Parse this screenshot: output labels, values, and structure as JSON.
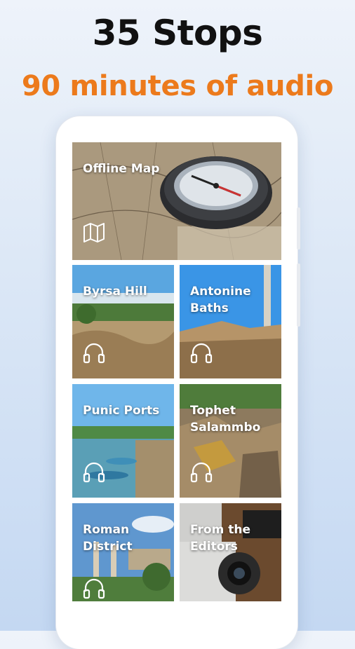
{
  "promo": {
    "headline": "35 Stops",
    "subheadline": "90 minutes of audio"
  },
  "colors": {
    "accent": "#ec7a1c",
    "headline": "#111111"
  },
  "tiles": [
    {
      "label": "Offline Map",
      "icon": "map-icon"
    },
    {
      "label": "Byrsa Hill",
      "icon": "headphones-icon"
    },
    {
      "label": "Antonine\nBaths",
      "icon": "headphones-icon"
    },
    {
      "label": "Punic Ports",
      "icon": "headphones-icon"
    },
    {
      "label": "Tophet\nSalammbo",
      "icon": "headphones-icon"
    },
    {
      "label": "Roman\nDistrict",
      "icon": "headphones-icon"
    },
    {
      "label": "From the\nEditors",
      "icon": ""
    }
  ]
}
